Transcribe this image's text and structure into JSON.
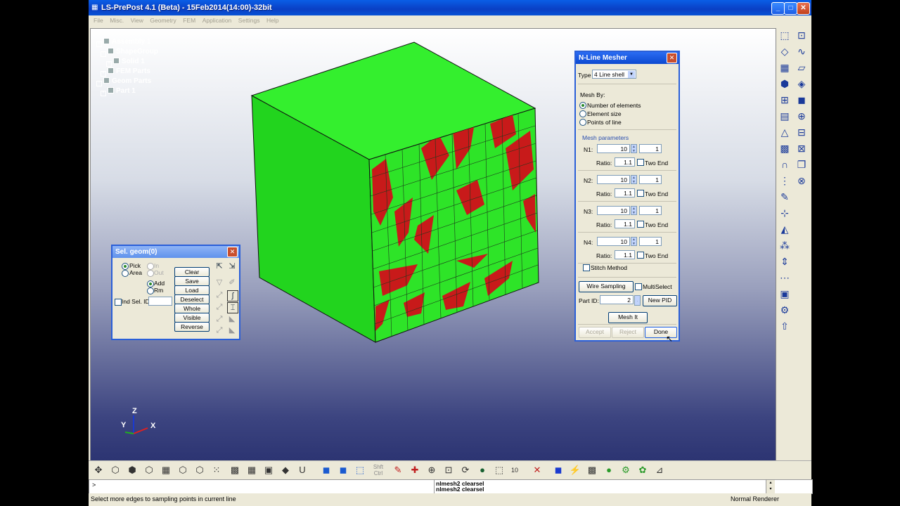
{
  "window": {
    "title": "LS-PrePost 4.1 (Beta) - 15Feb2014(14:00)-32bit",
    "app_icon": "app-icon"
  },
  "menu": [
    "File",
    "Misc.",
    "View",
    "Geometry",
    "FEM",
    "Application",
    "Settings",
    "Help"
  ],
  "tree": {
    "assembly": "Assembly 1",
    "shapegroup": "ShapeGroup",
    "solid": "Solid 1",
    "fem_parts": "FEM Parts",
    "geom_parts": "Geom Parts",
    "part": "Part 1"
  },
  "axes": {
    "z": "Z",
    "y": "Y",
    "x": "X"
  },
  "sel_geom": {
    "title": "Sel. geom(0)",
    "pick": "Pick",
    "area": "Area",
    "in": "In",
    "out": "Out",
    "add": "Add",
    "rm": "Rm",
    "ind_sel": "Ind Sel. ID",
    "buttons": [
      "Clear",
      "Save",
      "Load",
      "Deselect",
      "Whole",
      "Visible",
      "Reverse"
    ]
  },
  "mesher": {
    "title": "N-Line Mesher",
    "type_label": "Type",
    "type_value": "4 Line shell",
    "mesh_by": "Mesh By:",
    "opt_elements": "Number of elements",
    "opt_size": "Element size",
    "opt_points": "Points of line",
    "params": "Mesh parameters",
    "rows": [
      {
        "label": "N1:",
        "value": "10",
        "count": "1",
        "ratio_label": "Ratio:",
        "ratio": "1.1",
        "two_end": "Two End"
      },
      {
        "label": "N2:",
        "value": "10",
        "count": "1",
        "ratio_label": "Ratio:",
        "ratio": "1.1",
        "two_end": "Two End"
      },
      {
        "label": "N3:",
        "value": "10",
        "count": "1",
        "ratio_label": "Ratio:",
        "ratio": "1.1",
        "two_end": "Two End"
      },
      {
        "label": "N4:",
        "value": "10",
        "count": "1",
        "ratio_label": "Ratio:",
        "ratio": "1.1",
        "two_end": "Two End"
      }
    ],
    "stitch": "Stitch Method",
    "wire_sampling": "Wire Sampling",
    "multiselect": "MultiSelect",
    "part_id_label": "Part ID:",
    "part_id": "2",
    "new_pid": "New PID",
    "mesh_it": "Mesh It",
    "accept": "Accept",
    "reject": "Reject",
    "done": "Done"
  },
  "bottom": {
    "shft": "Shft",
    "ctrl": "Ctrl",
    "count": "10"
  },
  "cmd": {
    "prompt": ">",
    "history1": "nlmesh2 clearsel",
    "history2": "nlmesh2 clearsel"
  },
  "status": {
    "message": "Select more edges to sampling points in current line",
    "renderer": "Normal Renderer"
  },
  "colors": {
    "green": "#22e01e",
    "red": "#c81a1a",
    "titlebar": "#0a4fd8"
  }
}
